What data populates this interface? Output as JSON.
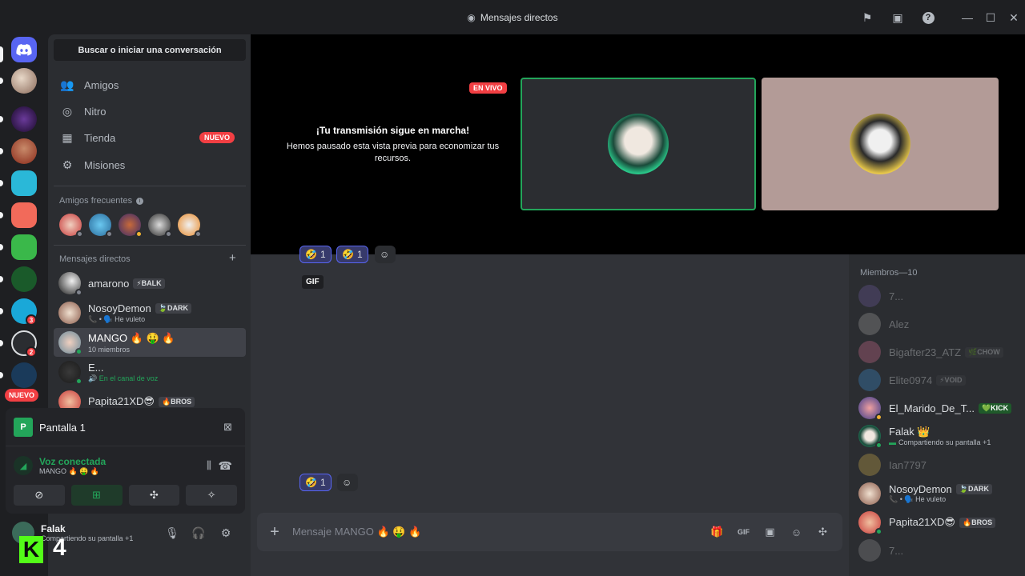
{
  "window": {
    "title": "Mensajes directos",
    "icons": [
      "inbox-flag-icon",
      "inbox-icon",
      "help-icon",
      "minimize-icon",
      "maximize-icon",
      "close-icon"
    ]
  },
  "rail": {
    "nuevo_label": "NUEVO",
    "badges": [
      "3",
      "2"
    ]
  },
  "sidebar": {
    "search_label": "Buscar o iniciar una conversación",
    "nav": [
      {
        "label": "Amigos",
        "icon": "friends-icon"
      },
      {
        "label": "Nitro",
        "icon": "nitro-icon"
      },
      {
        "label": "Tienda",
        "icon": "shop-icon",
        "badge": "NUEVO"
      },
      {
        "label": "Misiones",
        "icon": "quests-icon"
      }
    ],
    "frequent_title": "Amigos frecuentes",
    "dm_title": "Mensajes directos",
    "dms": [
      {
        "name": "amarono",
        "tag": "⚡BALK",
        "sub": ""
      },
      {
        "name": "NosoyDemon",
        "tag": "🍃DARK",
        "sub": "📞 • 🗣️ He vuleto"
      },
      {
        "name": "MANGO 🔥 🤑 🔥",
        "tag": "",
        "sub": "10 miembros"
      },
      {
        "name": "E...",
        "tag": "",
        "sub": "🔊 En el canal de voz"
      },
      {
        "name": "Papita21XD😎",
        "tag": "🔥BROS",
        "sub": ""
      }
    ]
  },
  "voice_panel": {
    "screen_label": "Pantalla 1",
    "voice_title": "Voz conectada",
    "voice_sub": "MANGO 🔥 🤑 🔥"
  },
  "user": {
    "name": "Falak",
    "status": "Compartiendo su pantalla +1"
  },
  "overlay": {
    "kick_number": "4"
  },
  "stream": {
    "live_label": "EN VIVO",
    "paused_title": "¡Tu transmisión sigue en marcha!",
    "paused_sub": "Hemos pausado esta vista previa para economizar tus recursos."
  },
  "chat": {
    "top_reactions": [
      {
        "emoji": "🤣",
        "count": "1"
      },
      {
        "emoji": "🤣",
        "count": "1"
      }
    ],
    "gif_label": "GIF",
    "bottom_reaction": {
      "emoji": "🤣",
      "count": "1"
    },
    "placeholder": "Mensaje MANGO 🔥 🤑 🔥"
  },
  "members": {
    "title": "Miembros—10",
    "list": [
      {
        "name": "7...",
        "tag": "",
        "sub": "",
        "online": false
      },
      {
        "name": "Alez",
        "tag": "",
        "sub": "",
        "online": false
      },
      {
        "name": "Bigafter23_ATZ",
        "tag": "🌿CHOW",
        "sub": "",
        "online": false
      },
      {
        "name": "Elite0974",
        "tag": "⚡VOID",
        "sub": "",
        "online": false
      },
      {
        "name": "El_Marido_De_T...",
        "tag": "💚KICK",
        "sub": "",
        "online": true
      },
      {
        "name": "Falak 👑",
        "tag": "",
        "sub": "Compartiendo su pantalla +1",
        "online": true
      },
      {
        "name": "Ian7797",
        "tag": "",
        "sub": "",
        "online": false
      },
      {
        "name": "NosoyDemon",
        "tag": "🍃DARK",
        "sub": "📞 • 🗣️ He vuleto",
        "online": true
      },
      {
        "name": "Papita21XD😎",
        "tag": "🔥BROS",
        "sub": "",
        "online": true
      },
      {
        "name": "7...",
        "tag": "",
        "sub": "",
        "online": false
      }
    ]
  },
  "colors": {
    "green": "#23a55a",
    "red": "#f23f43",
    "blurple": "#5865f2",
    "kick_green": "#53fc18"
  }
}
